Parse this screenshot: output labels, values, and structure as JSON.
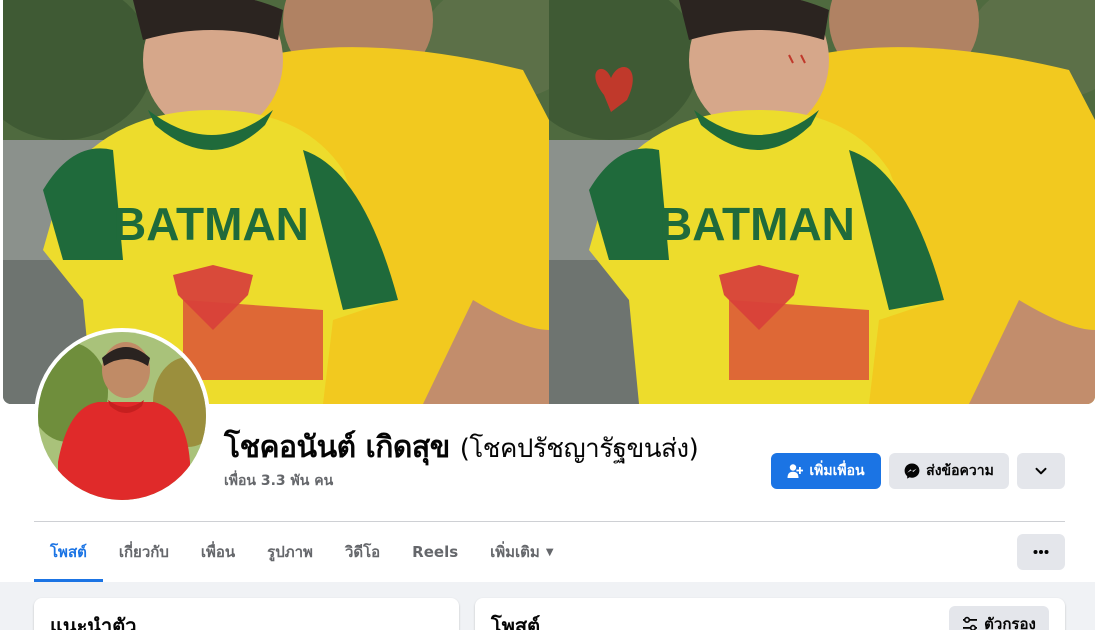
{
  "profile": {
    "name": "โชคอนันต์ เกิดสุข",
    "alternate_name": "(โชคปรัชญารัฐขนส่ง)",
    "friend_count": "เพื่อน 3.3 พัน คน"
  },
  "actions": {
    "add_friend": "เพิ่มเพื่อน",
    "message": "ส่งข้อความ"
  },
  "tabs": [
    {
      "label": "โพสต์",
      "active": true
    },
    {
      "label": "เกี่ยวกับ",
      "active": false
    },
    {
      "label": "เพื่อน",
      "active": false
    },
    {
      "label": "รูปภาพ",
      "active": false
    },
    {
      "label": "วิดีโอ",
      "active": false
    },
    {
      "label": "Reels",
      "active": false
    },
    {
      "label": "เพิ่มเติม",
      "active": false
    }
  ],
  "cards": {
    "intro_title": "แนะนำตัว",
    "posts_title": "โพสต์",
    "filter_label": "ตัวกรอง"
  },
  "cover_photo": {
    "shirt_print": "BATMAN"
  },
  "icons": {
    "add_friend": "person-plus-icon",
    "message": "messenger-icon",
    "dropdown": "chevron-down-icon",
    "more": "more-horizontal-icon",
    "filter": "sliders-icon",
    "tab_more": "caret-down-icon"
  },
  "colors": {
    "accent": "#1b74e4",
    "page_background": "#f0f2f5",
    "button_secondary": "#e4e6eb",
    "text_primary": "#050505",
    "text_secondary": "#65676b"
  }
}
